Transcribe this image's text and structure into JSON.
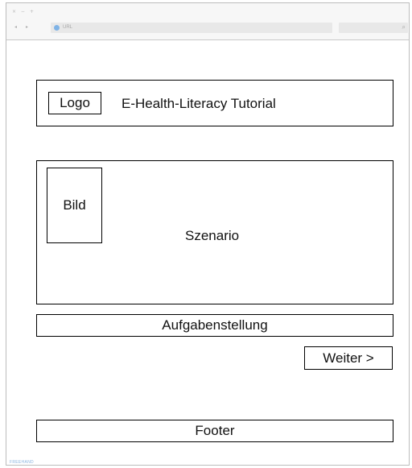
{
  "browser": {
    "window_controls": "× − +",
    "back_icon": "◂",
    "forward_icon": "▸",
    "address_placeholder": "URL",
    "search_icon": "⌕"
  },
  "header": {
    "logo_label": "Logo",
    "title": "E-Health-Literacy Tutorial"
  },
  "scenario": {
    "image_label": "Bild",
    "label": "Szenario"
  },
  "task": {
    "label": "Aufgabenstellung"
  },
  "navigation": {
    "next_label": "Weiter >"
  },
  "footer": {
    "label": "Footer"
  },
  "watermark": "FREEHAND"
}
